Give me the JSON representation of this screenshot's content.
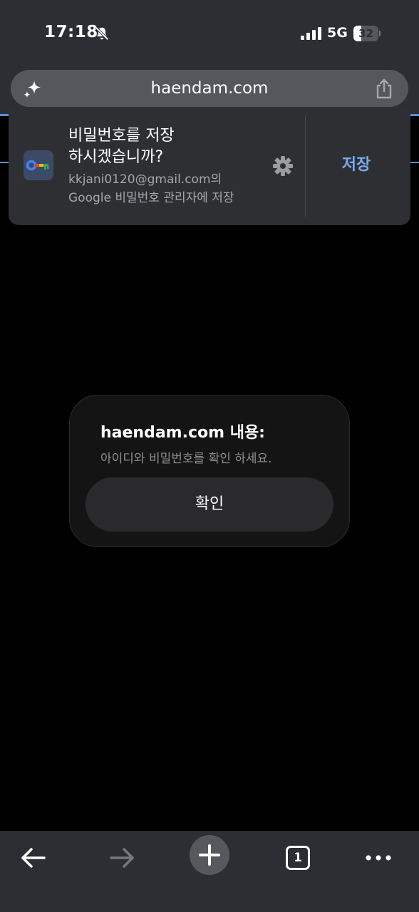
{
  "status_bar": {
    "time": "17:18",
    "network": "5G",
    "battery_level": "32",
    "battery_fraction": 0.32
  },
  "url_bar": {
    "url": "haendam.com"
  },
  "password_prompt": {
    "title_line1": "비밀번호를 저장",
    "title_line2": "하시겠습니까?",
    "subtitle_line1": "kkjani0120@gmail.com의",
    "subtitle_line2": "Google 비밀번호 관리자에 저장",
    "save_label": "저장"
  },
  "alert": {
    "title": "haendam.com 내용:",
    "message": "아이디와 비밀번호를 확인 하세요.",
    "confirm_label": "확인"
  },
  "toolbar": {
    "tab_count": "1"
  },
  "colors": {
    "chrome_bg": "#2c2e33",
    "accent_blue": "#7aacf0",
    "dialog_bg": "#141414",
    "button_bg": "#2a2a2c"
  }
}
